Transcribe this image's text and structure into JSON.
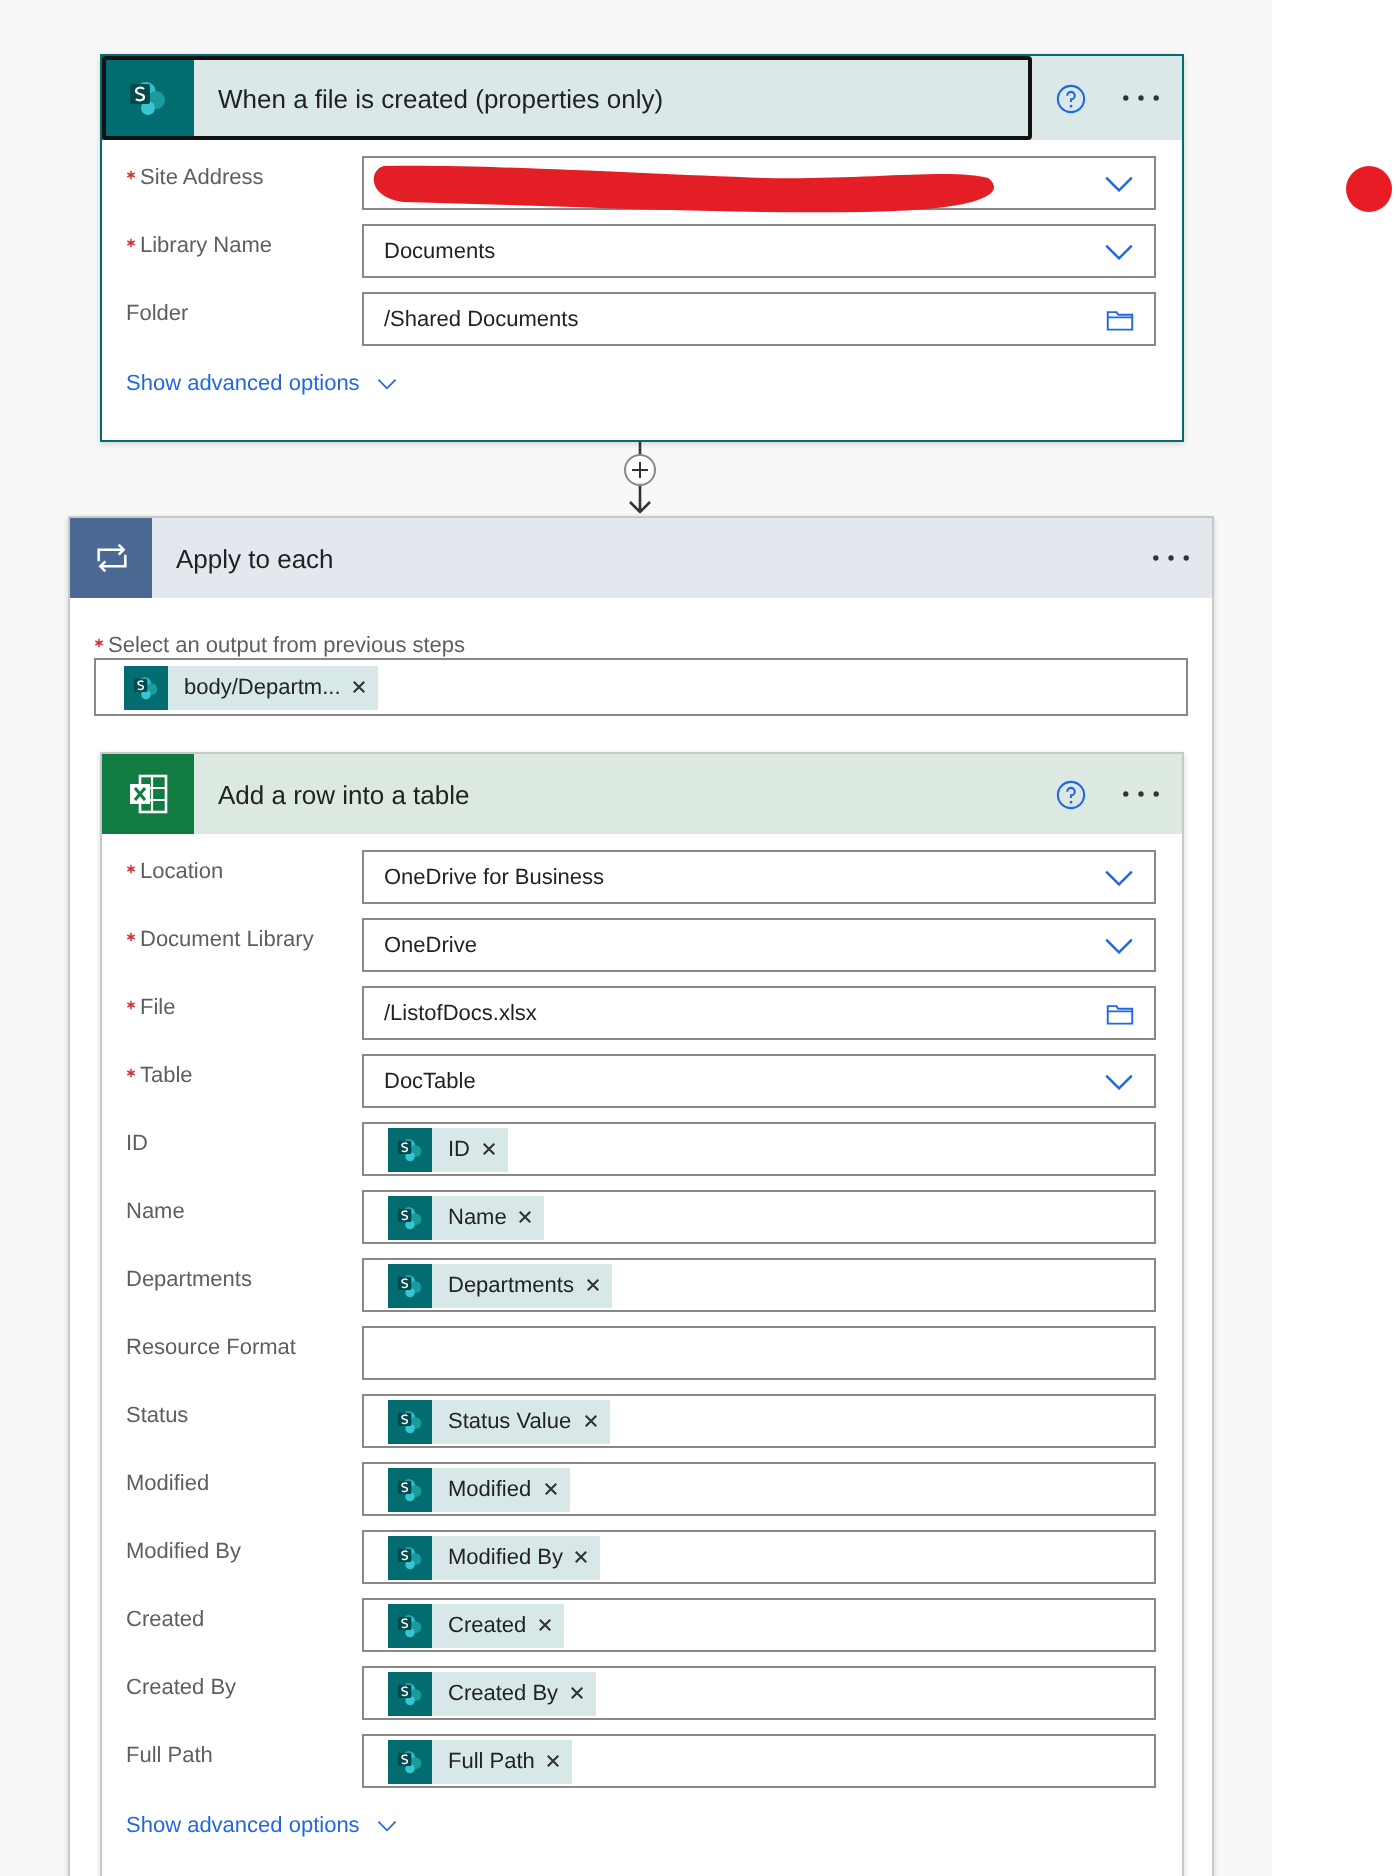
{
  "trigger": {
    "title": "When a file is created (properties only)",
    "focused": true,
    "fields": [
      {
        "label": "Site Address",
        "required": true,
        "kind": "dropdown",
        "redacted": true
      },
      {
        "label": "Library Name",
        "required": true,
        "kind": "dropdown",
        "value": "Documents"
      },
      {
        "label": "Folder",
        "required": false,
        "kind": "folder",
        "value": "/Shared Documents"
      }
    ],
    "advanced": "Show advanced options"
  },
  "loop": {
    "title": "Apply to each",
    "output_label": "Select an output from previous steps",
    "output_required": true,
    "output_tokens": [
      "body/Departm..."
    ],
    "action": {
      "title": "Add a row into a table",
      "fields": [
        {
          "label": "Location",
          "required": true,
          "kind": "dropdown",
          "value": "OneDrive for Business"
        },
        {
          "label": "Document Library",
          "required": true,
          "kind": "dropdown",
          "value": "OneDrive"
        },
        {
          "label": "File",
          "required": true,
          "kind": "folder",
          "value": "/ListofDocs.xlsx"
        },
        {
          "label": "Table",
          "required": true,
          "kind": "dropdown",
          "value": "DocTable"
        },
        {
          "label": "ID",
          "required": false,
          "kind": "tokens",
          "tokens": [
            "ID"
          ]
        },
        {
          "label": "Name",
          "required": false,
          "kind": "tokens",
          "tokens": [
            "Name"
          ]
        },
        {
          "label": "Departments",
          "required": false,
          "kind": "tokens",
          "tokens": [
            "Departments"
          ]
        },
        {
          "label": "Resource Format",
          "required": false,
          "kind": "text"
        },
        {
          "label": "Status",
          "required": false,
          "kind": "tokens",
          "tokens": [
            "Status Value"
          ]
        },
        {
          "label": "Modified",
          "required": false,
          "kind": "tokens",
          "tokens": [
            "Modified"
          ]
        },
        {
          "label": "Modified By",
          "required": false,
          "kind": "tokens",
          "tokens": [
            "Modified By"
          ]
        },
        {
          "label": "Created",
          "required": false,
          "kind": "tokens",
          "tokens": [
            "Created"
          ]
        },
        {
          "label": "Created By",
          "required": false,
          "kind": "tokens",
          "tokens": [
            "Created By"
          ]
        },
        {
          "label": "Full Path",
          "required": false,
          "kind": "tokens",
          "tokens": [
            "Full Path"
          ]
        }
      ],
      "advanced": "Show advanced options"
    }
  }
}
